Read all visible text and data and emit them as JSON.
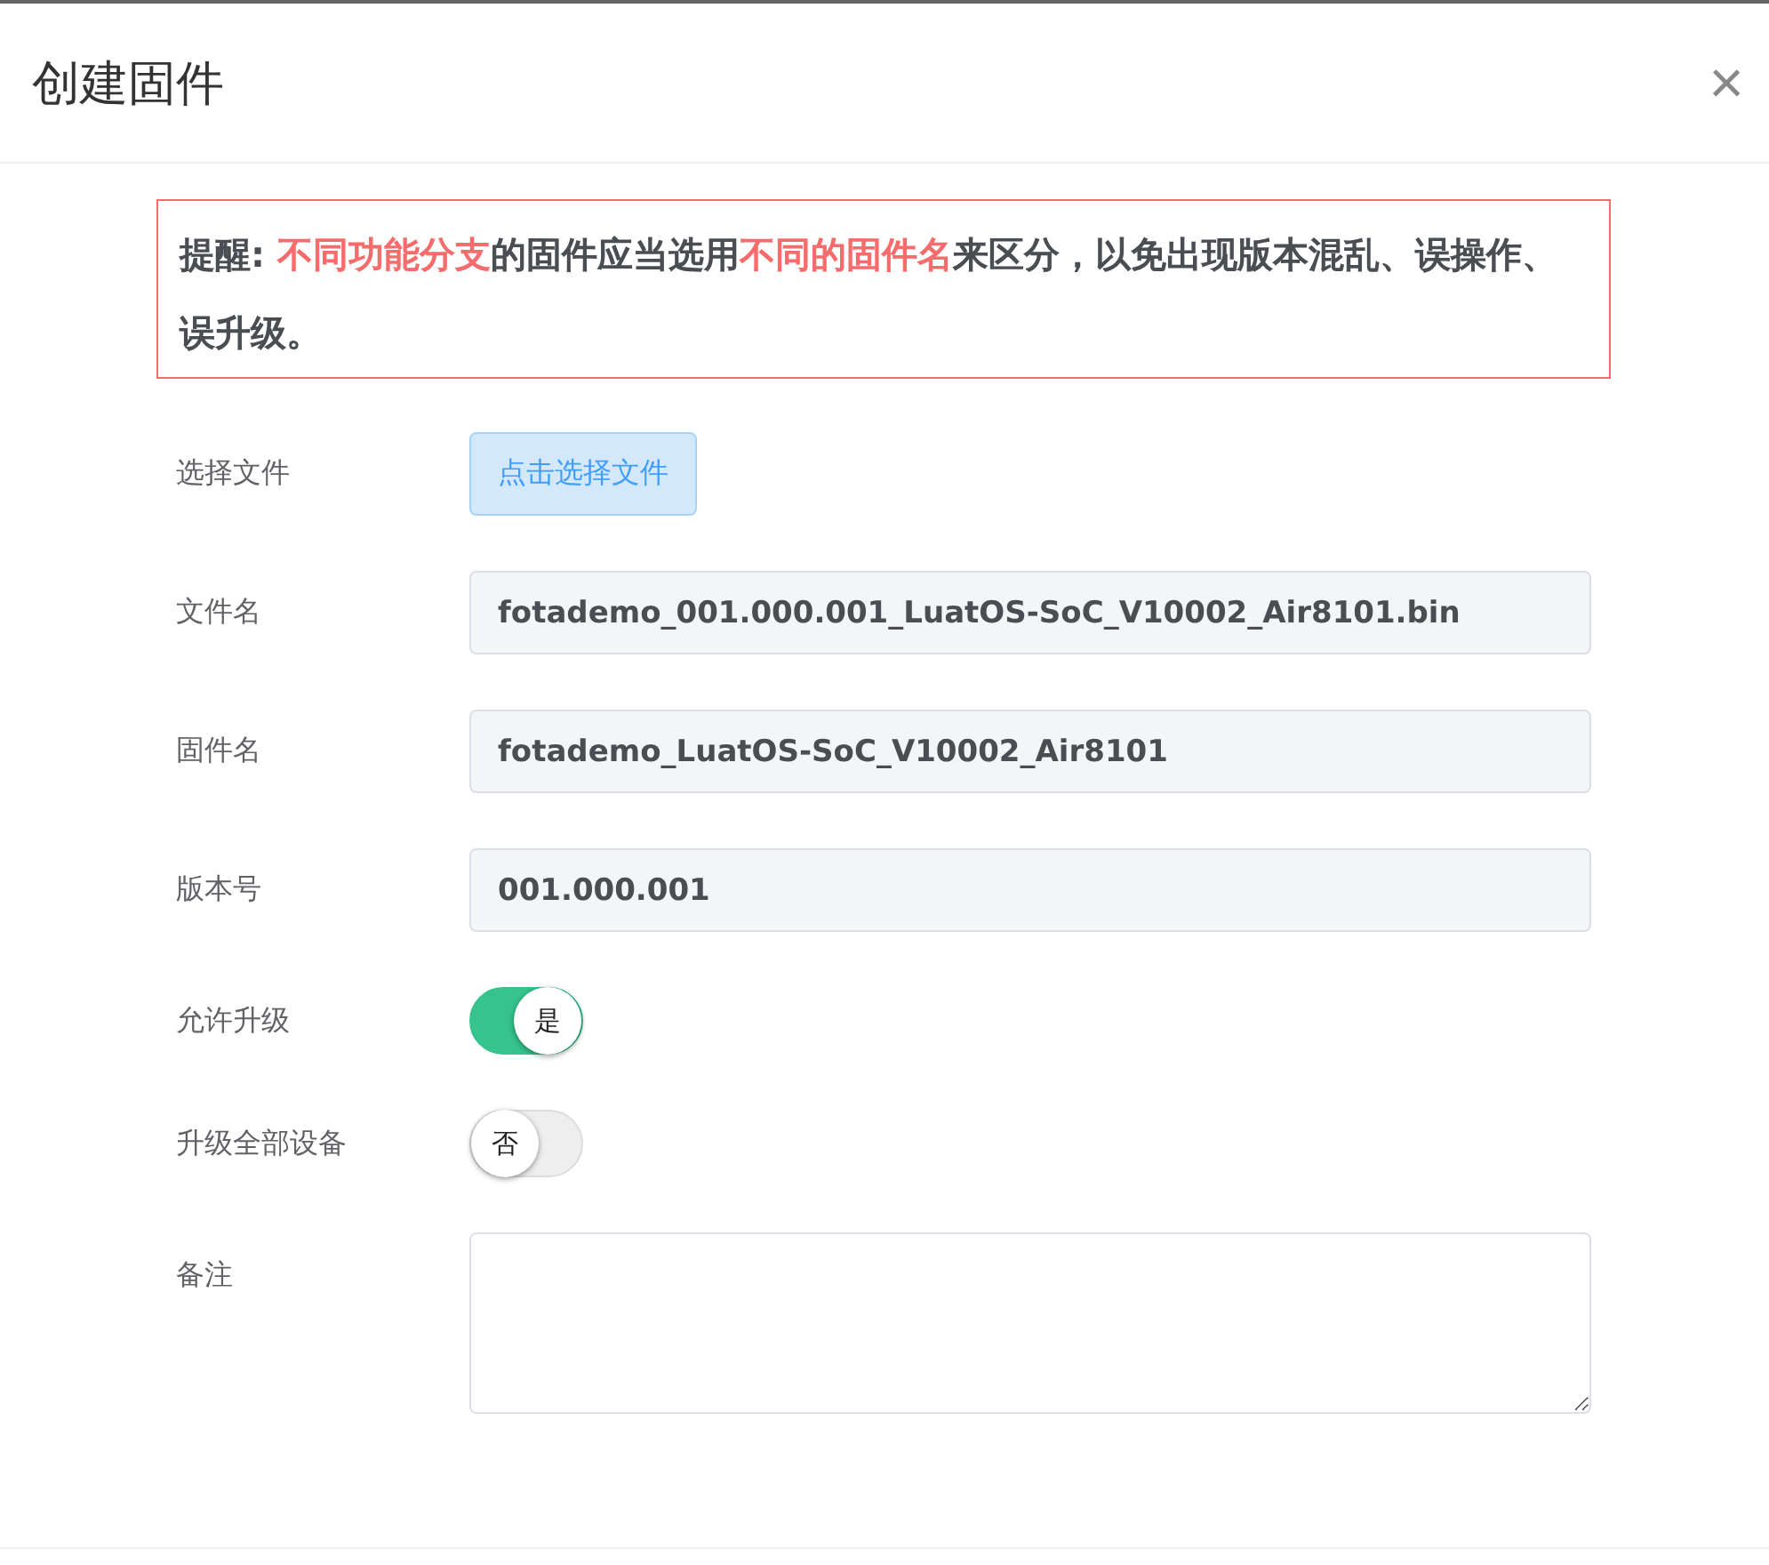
{
  "dialog": {
    "title": "创建固件",
    "close": "×"
  },
  "alert": {
    "segments": [
      {
        "kind": "normal",
        "text": "提醒: "
      },
      {
        "kind": "highlight",
        "text": "不同功能分支"
      },
      {
        "kind": "normal",
        "text": "的固件应当选用"
      },
      {
        "kind": "highlight",
        "text": "不同的固件名"
      },
      {
        "kind": "normal",
        "text": "来区分，以免出现版本混乱、误操作、误升级。"
      }
    ]
  },
  "form": [
    {
      "label": "选择文件",
      "kind": "button",
      "text": "点击选择文件"
    },
    {
      "label": "文件名",
      "kind": "input",
      "value": "fotademo_001.000.001_LuatOS-SoC_V10002_Air8101.bin",
      "disabled": true
    },
    {
      "label": "固件名",
      "kind": "input",
      "value": "fotademo_LuatOS-SoC_V10002_Air8101",
      "disabled": true
    },
    {
      "label": "版本号",
      "kind": "input",
      "value": "001.000.001",
      "disabled": true
    },
    {
      "label": "允许升级",
      "kind": "switch",
      "on": true,
      "text": "是"
    },
    {
      "label": "升级全部设备",
      "kind": "switch",
      "on": false,
      "text": "否"
    },
    {
      "label": "备注",
      "kind": "textarea"
    }
  ]
}
